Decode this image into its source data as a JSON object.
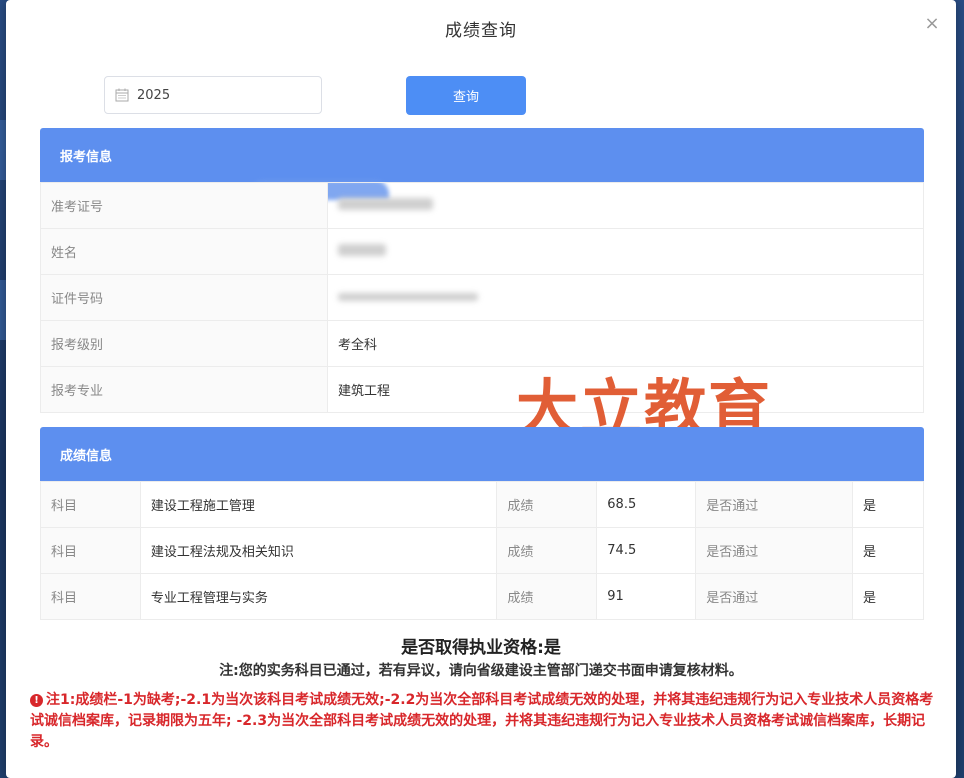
{
  "modal": {
    "title": "成绩查询",
    "close_symbol": "×"
  },
  "search": {
    "year_value": "2025",
    "query_label": "查询"
  },
  "registration": {
    "header": "报考信息",
    "rows": [
      {
        "label": "准考证号",
        "value": ""
      },
      {
        "label": "姓名",
        "value": ""
      },
      {
        "label": "证件号码",
        "value": ""
      },
      {
        "label": "报考级别",
        "value": "考全科"
      },
      {
        "label": "报考专业",
        "value": "建筑工程"
      }
    ]
  },
  "scores": {
    "header": "成绩信息",
    "subject_label": "科目",
    "score_label": "成绩",
    "pass_label": "是否通过",
    "rows": [
      {
        "subject": "建设工程施工管理",
        "score": "68.5",
        "passed": "是"
      },
      {
        "subject": "建设工程法规及相关知识",
        "score": "74.5",
        "passed": "是"
      },
      {
        "subject": "专业工程管理与实务",
        "score": "91",
        "passed": "是"
      }
    ]
  },
  "watermark": "大立教育",
  "qualification": {
    "result": "是否取得执业资格:是",
    "note": "注:您的实务科目已通过，若有异议，请向省级建设主管部门递交书面申请复核材料。"
  },
  "disclaimer": "注1:成绩栏-1为缺考;-2.1为当次该科目考试成绩无效;-2.2为当次全部科目考试成绩无效的处理，并将其违纪违规行为记入专业技术人员资格考试诚信档案库，记录期限为五年; -2.3为当次全部科目考试成绩无效的处理，并将其违纪违规行为记入专业技术人员资格考试诚信档案库，长期记录。",
  "colors": {
    "accent": "#4d8ef5",
    "section_header": "#5d8fef",
    "warning": "#d8272b",
    "watermark": "#e0562c"
  }
}
